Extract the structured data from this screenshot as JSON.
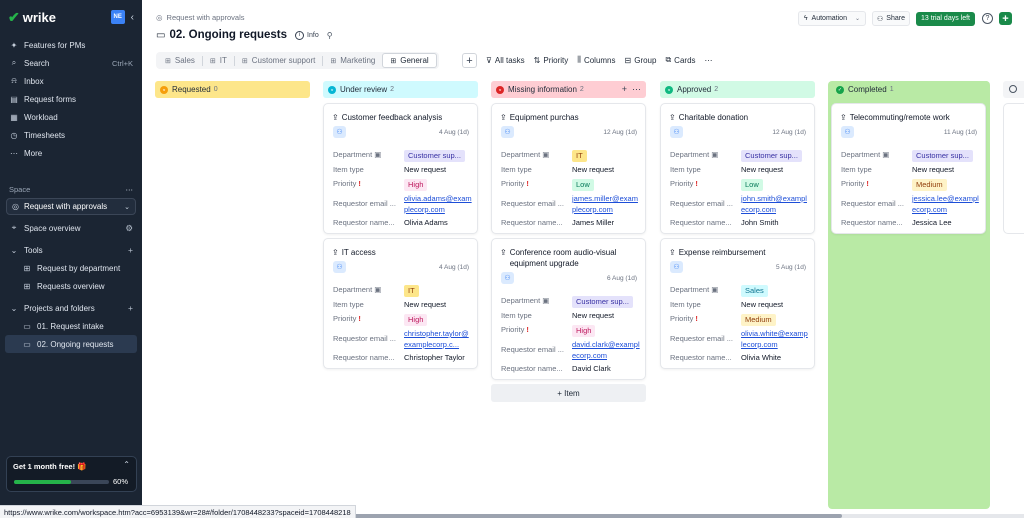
{
  "sidebar": {
    "logo": "wrike",
    "user_initials": "NE",
    "nav": [
      {
        "icon": "sparkle-icon",
        "glyph": "✨",
        "label": "Features for PMs"
      },
      {
        "icon": "search-icon",
        "glyph": "⌕",
        "label": "Search",
        "shortcut": "Ctrl+K"
      },
      {
        "icon": "inbox-icon",
        "glyph": "🔔",
        "label": "Inbox"
      },
      {
        "icon": "forms-icon",
        "glyph": "▤",
        "label": "Request forms"
      },
      {
        "icon": "workload-icon",
        "glyph": "▦",
        "label": "Workload"
      },
      {
        "icon": "clock-icon",
        "glyph": "◷",
        "label": "Timesheets"
      },
      {
        "icon": "more-icon",
        "glyph": "···",
        "label": "More"
      }
    ],
    "space_label": "Space",
    "space_selected": "Request with approvals",
    "space_overview": "Space overview",
    "tools_label": "Tools",
    "tools": [
      "Request by department",
      "Requests overview"
    ],
    "projects_label": "Projects and folders",
    "projects": [
      "01. Request intake",
      "02. Ongoing requests"
    ],
    "promo": {
      "text": "Get 1 month free! 🎁",
      "progress": 0.6,
      "percent_label": "60%"
    }
  },
  "header": {
    "breadcrumb": "Request with approvals",
    "title": "02. Ongoing requests",
    "info_label": "Info",
    "automation_label": "Automation",
    "share_label": "Share",
    "trial_label": "13 trial days left"
  },
  "tabs": [
    {
      "label": "Sales",
      "active": false
    },
    {
      "label": "IT",
      "active": false
    },
    {
      "label": "Customer support",
      "active": false
    },
    {
      "label": "Marketing",
      "active": false
    },
    {
      "label": "General",
      "active": true
    }
  ],
  "toolbar": {
    "all_tasks": "All tasks",
    "priority": "Priority",
    "columns": "Columns",
    "group": "Group",
    "cards": "Cards"
  },
  "field_labels": {
    "department": "Department",
    "item_type": "Item type",
    "priority": "Priority",
    "requestor_email": "Requestor email ...",
    "requestor_name": "Requestor name..."
  },
  "columns": [
    {
      "name": "Requested",
      "count": "0",
      "color": "#fde68a",
      "dot": "#f59e0b"
    },
    {
      "name": "Under review",
      "count": "2",
      "color": "#cffafe",
      "dot": "#06b6d4"
    },
    {
      "name": "Missing information",
      "count": "2",
      "color": "#fecdd3",
      "dot": "#dc2626"
    },
    {
      "name": "Approved",
      "count": "2",
      "color": "#d1fae5",
      "dot": "#10b981"
    },
    {
      "name": "Completed",
      "count": "1",
      "color": "#b9eaa5",
      "dot": "#16a34a"
    }
  ],
  "cards": {
    "c1": {
      "title": "Customer feedback analysis",
      "date": "4 Aug (1d)",
      "department": "Customer sup...",
      "item_type": "New request",
      "priority": "High",
      "email": "olivia.adams@examplecorp.com",
      "name": "Olivia Adams"
    },
    "c2": {
      "title": "IT access",
      "date": "4 Aug (1d)",
      "department": "IT",
      "item_type": "New request",
      "priority": "High",
      "email": "christopher.taylor@examplecorp.c...",
      "name": "Christopher Taylor"
    },
    "c3": {
      "title": "Equipment purchas",
      "date": "12 Aug (1d)",
      "department": "IT",
      "item_type": "New request",
      "priority": "Low",
      "email": "james.miller@examplecorp.com",
      "name": "James Miller"
    },
    "c4": {
      "title": "Conference room audio-visual equipment upgrade",
      "date": "6 Aug (1d)",
      "department": "Customer sup...",
      "item_type": "New request",
      "priority": "High",
      "email": "david.clark@examplecorp.com",
      "name": "David Clark"
    },
    "c5": {
      "title": "Charitable donation",
      "date": "12 Aug (1d)",
      "department": "Customer sup...",
      "item_type": "New request",
      "priority": "Low",
      "email": "john.smith@examplecorp.com",
      "name": "John Smith"
    },
    "c6": {
      "title": "Expense reimbursement",
      "date": "5 Aug (1d)",
      "department": "Sales",
      "item_type": "New request",
      "priority": "Medium",
      "email": "olivia.white@examplecorp.com",
      "name": "Olivia White"
    },
    "c7": {
      "title": "Telecommuting/remote work",
      "date": "11 Aug (1d)",
      "department": "Customer sup...",
      "item_type": "New request",
      "priority": "Medium",
      "email": "jessica.lee@examplecorp.com",
      "name": "Jessica Lee"
    }
  },
  "add_item_label": "+ Item",
  "status_url": "https://www.wrike.com/workspace.htm?acc=6953139&wr=28#/folder/1708448233?spaceid=1708448218"
}
